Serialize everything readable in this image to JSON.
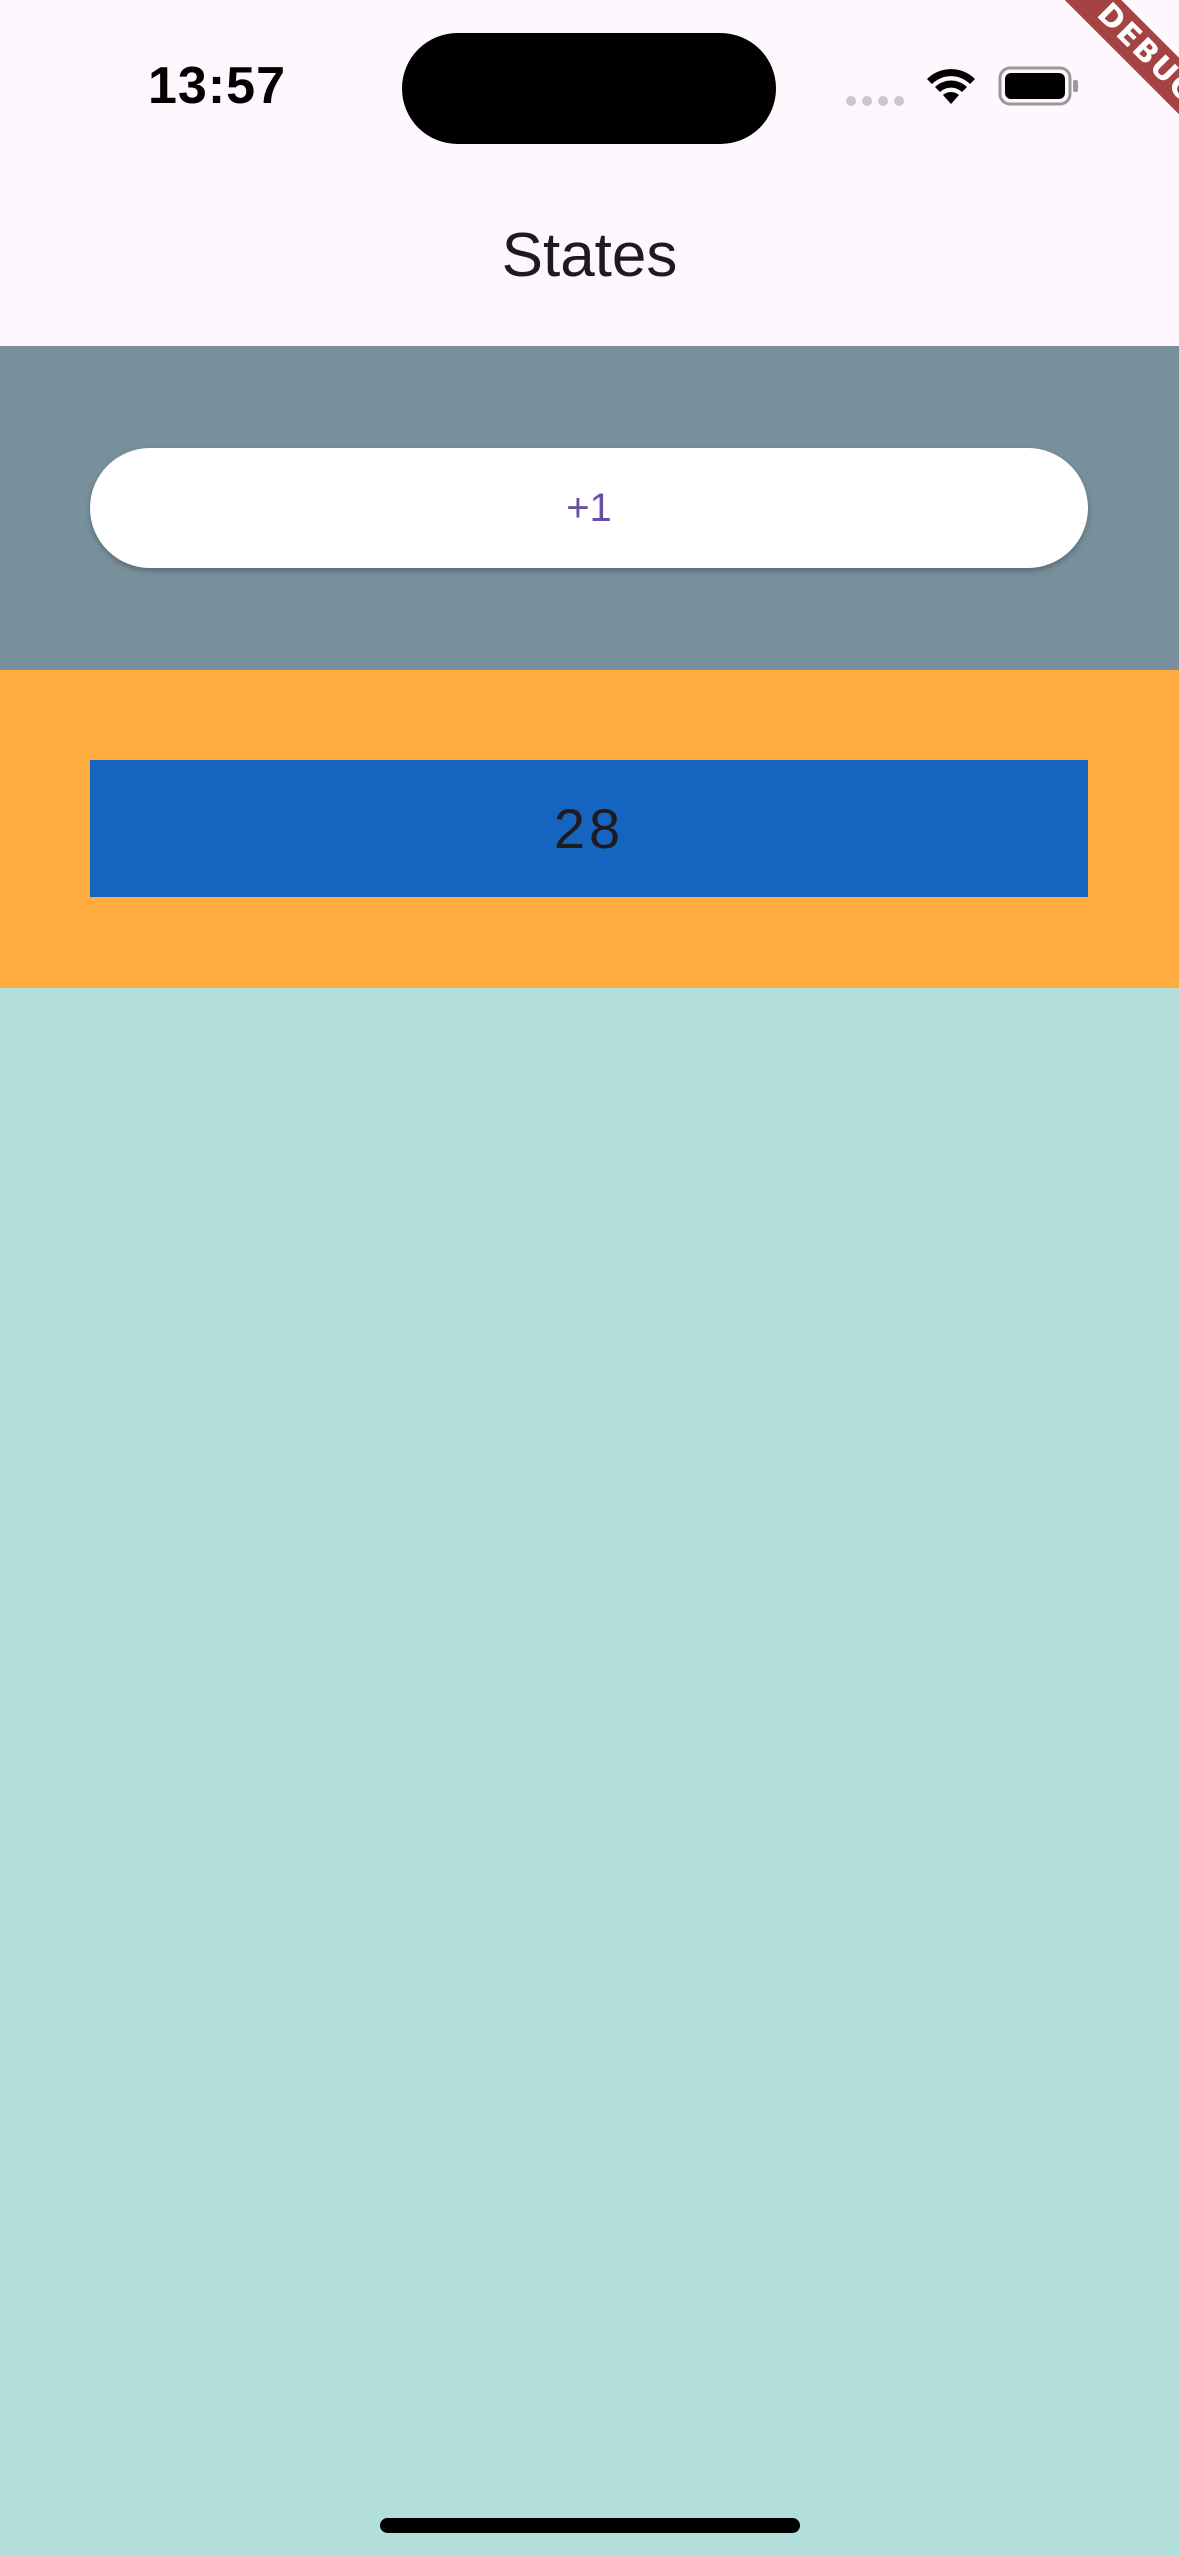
{
  "status_bar": {
    "time": "13:57",
    "icons": [
      "cellular-signal-icon",
      "wifi-icon",
      "battery-icon"
    ]
  },
  "debug_banner": {
    "label": "DEBUG"
  },
  "app_bar": {
    "title": "States"
  },
  "actions": {
    "increment_label": "+1"
  },
  "counter": {
    "value": "28"
  },
  "colors": {
    "app_bar_background": "#fff7fe",
    "button_section_background": "#78909c",
    "counter_section_background": "#ffab40",
    "counter_box_background": "#1565c0",
    "content_background": "#b2dfdb",
    "button_text": "#6750a4",
    "debug_ribbon": "#a54342"
  }
}
